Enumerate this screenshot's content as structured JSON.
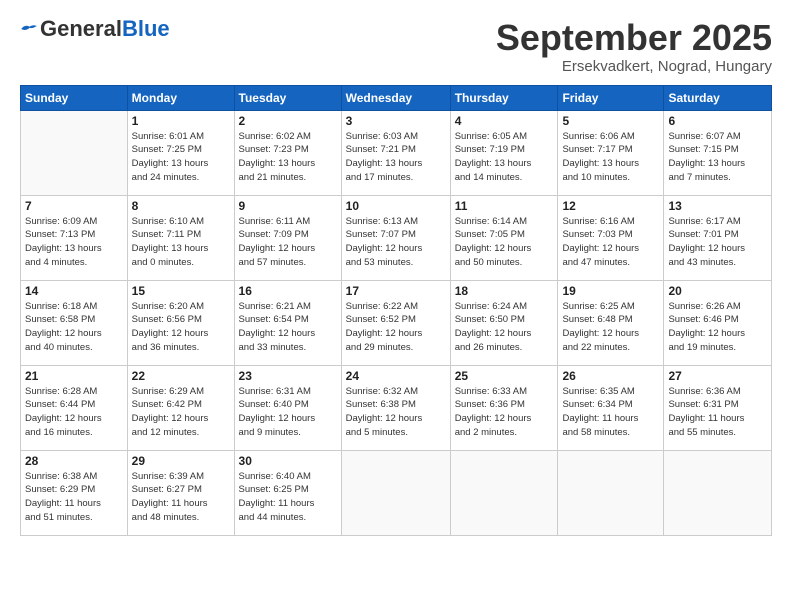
{
  "header": {
    "logo_general": "General",
    "logo_blue": "Blue",
    "month": "September 2025",
    "location": "Ersekvadkert, Nograd, Hungary"
  },
  "weekdays": [
    "Sunday",
    "Monday",
    "Tuesday",
    "Wednesday",
    "Thursday",
    "Friday",
    "Saturday"
  ],
  "weeks": [
    [
      {
        "day": "",
        "info": ""
      },
      {
        "day": "1",
        "info": "Sunrise: 6:01 AM\nSunset: 7:25 PM\nDaylight: 13 hours\nand 24 minutes."
      },
      {
        "day": "2",
        "info": "Sunrise: 6:02 AM\nSunset: 7:23 PM\nDaylight: 13 hours\nand 21 minutes."
      },
      {
        "day": "3",
        "info": "Sunrise: 6:03 AM\nSunset: 7:21 PM\nDaylight: 13 hours\nand 17 minutes."
      },
      {
        "day": "4",
        "info": "Sunrise: 6:05 AM\nSunset: 7:19 PM\nDaylight: 13 hours\nand 14 minutes."
      },
      {
        "day": "5",
        "info": "Sunrise: 6:06 AM\nSunset: 7:17 PM\nDaylight: 13 hours\nand 10 minutes."
      },
      {
        "day": "6",
        "info": "Sunrise: 6:07 AM\nSunset: 7:15 PM\nDaylight: 13 hours\nand 7 minutes."
      }
    ],
    [
      {
        "day": "7",
        "info": "Sunrise: 6:09 AM\nSunset: 7:13 PM\nDaylight: 13 hours\nand 4 minutes."
      },
      {
        "day": "8",
        "info": "Sunrise: 6:10 AM\nSunset: 7:11 PM\nDaylight: 13 hours\nand 0 minutes."
      },
      {
        "day": "9",
        "info": "Sunrise: 6:11 AM\nSunset: 7:09 PM\nDaylight: 12 hours\nand 57 minutes."
      },
      {
        "day": "10",
        "info": "Sunrise: 6:13 AM\nSunset: 7:07 PM\nDaylight: 12 hours\nand 53 minutes."
      },
      {
        "day": "11",
        "info": "Sunrise: 6:14 AM\nSunset: 7:05 PM\nDaylight: 12 hours\nand 50 minutes."
      },
      {
        "day": "12",
        "info": "Sunrise: 6:16 AM\nSunset: 7:03 PM\nDaylight: 12 hours\nand 47 minutes."
      },
      {
        "day": "13",
        "info": "Sunrise: 6:17 AM\nSunset: 7:01 PM\nDaylight: 12 hours\nand 43 minutes."
      }
    ],
    [
      {
        "day": "14",
        "info": "Sunrise: 6:18 AM\nSunset: 6:58 PM\nDaylight: 12 hours\nand 40 minutes."
      },
      {
        "day": "15",
        "info": "Sunrise: 6:20 AM\nSunset: 6:56 PM\nDaylight: 12 hours\nand 36 minutes."
      },
      {
        "day": "16",
        "info": "Sunrise: 6:21 AM\nSunset: 6:54 PM\nDaylight: 12 hours\nand 33 minutes."
      },
      {
        "day": "17",
        "info": "Sunrise: 6:22 AM\nSunset: 6:52 PM\nDaylight: 12 hours\nand 29 minutes."
      },
      {
        "day": "18",
        "info": "Sunrise: 6:24 AM\nSunset: 6:50 PM\nDaylight: 12 hours\nand 26 minutes."
      },
      {
        "day": "19",
        "info": "Sunrise: 6:25 AM\nSunset: 6:48 PM\nDaylight: 12 hours\nand 22 minutes."
      },
      {
        "day": "20",
        "info": "Sunrise: 6:26 AM\nSunset: 6:46 PM\nDaylight: 12 hours\nand 19 minutes."
      }
    ],
    [
      {
        "day": "21",
        "info": "Sunrise: 6:28 AM\nSunset: 6:44 PM\nDaylight: 12 hours\nand 16 minutes."
      },
      {
        "day": "22",
        "info": "Sunrise: 6:29 AM\nSunset: 6:42 PM\nDaylight: 12 hours\nand 12 minutes."
      },
      {
        "day": "23",
        "info": "Sunrise: 6:31 AM\nSunset: 6:40 PM\nDaylight: 12 hours\nand 9 minutes."
      },
      {
        "day": "24",
        "info": "Sunrise: 6:32 AM\nSunset: 6:38 PM\nDaylight: 12 hours\nand 5 minutes."
      },
      {
        "day": "25",
        "info": "Sunrise: 6:33 AM\nSunset: 6:36 PM\nDaylight: 12 hours\nand 2 minutes."
      },
      {
        "day": "26",
        "info": "Sunrise: 6:35 AM\nSunset: 6:34 PM\nDaylight: 11 hours\nand 58 minutes."
      },
      {
        "day": "27",
        "info": "Sunrise: 6:36 AM\nSunset: 6:31 PM\nDaylight: 11 hours\nand 55 minutes."
      }
    ],
    [
      {
        "day": "28",
        "info": "Sunrise: 6:38 AM\nSunset: 6:29 PM\nDaylight: 11 hours\nand 51 minutes."
      },
      {
        "day": "29",
        "info": "Sunrise: 6:39 AM\nSunset: 6:27 PM\nDaylight: 11 hours\nand 48 minutes."
      },
      {
        "day": "30",
        "info": "Sunrise: 6:40 AM\nSunset: 6:25 PM\nDaylight: 11 hours\nand 44 minutes."
      },
      {
        "day": "",
        "info": ""
      },
      {
        "day": "",
        "info": ""
      },
      {
        "day": "",
        "info": ""
      },
      {
        "day": "",
        "info": ""
      }
    ]
  ]
}
